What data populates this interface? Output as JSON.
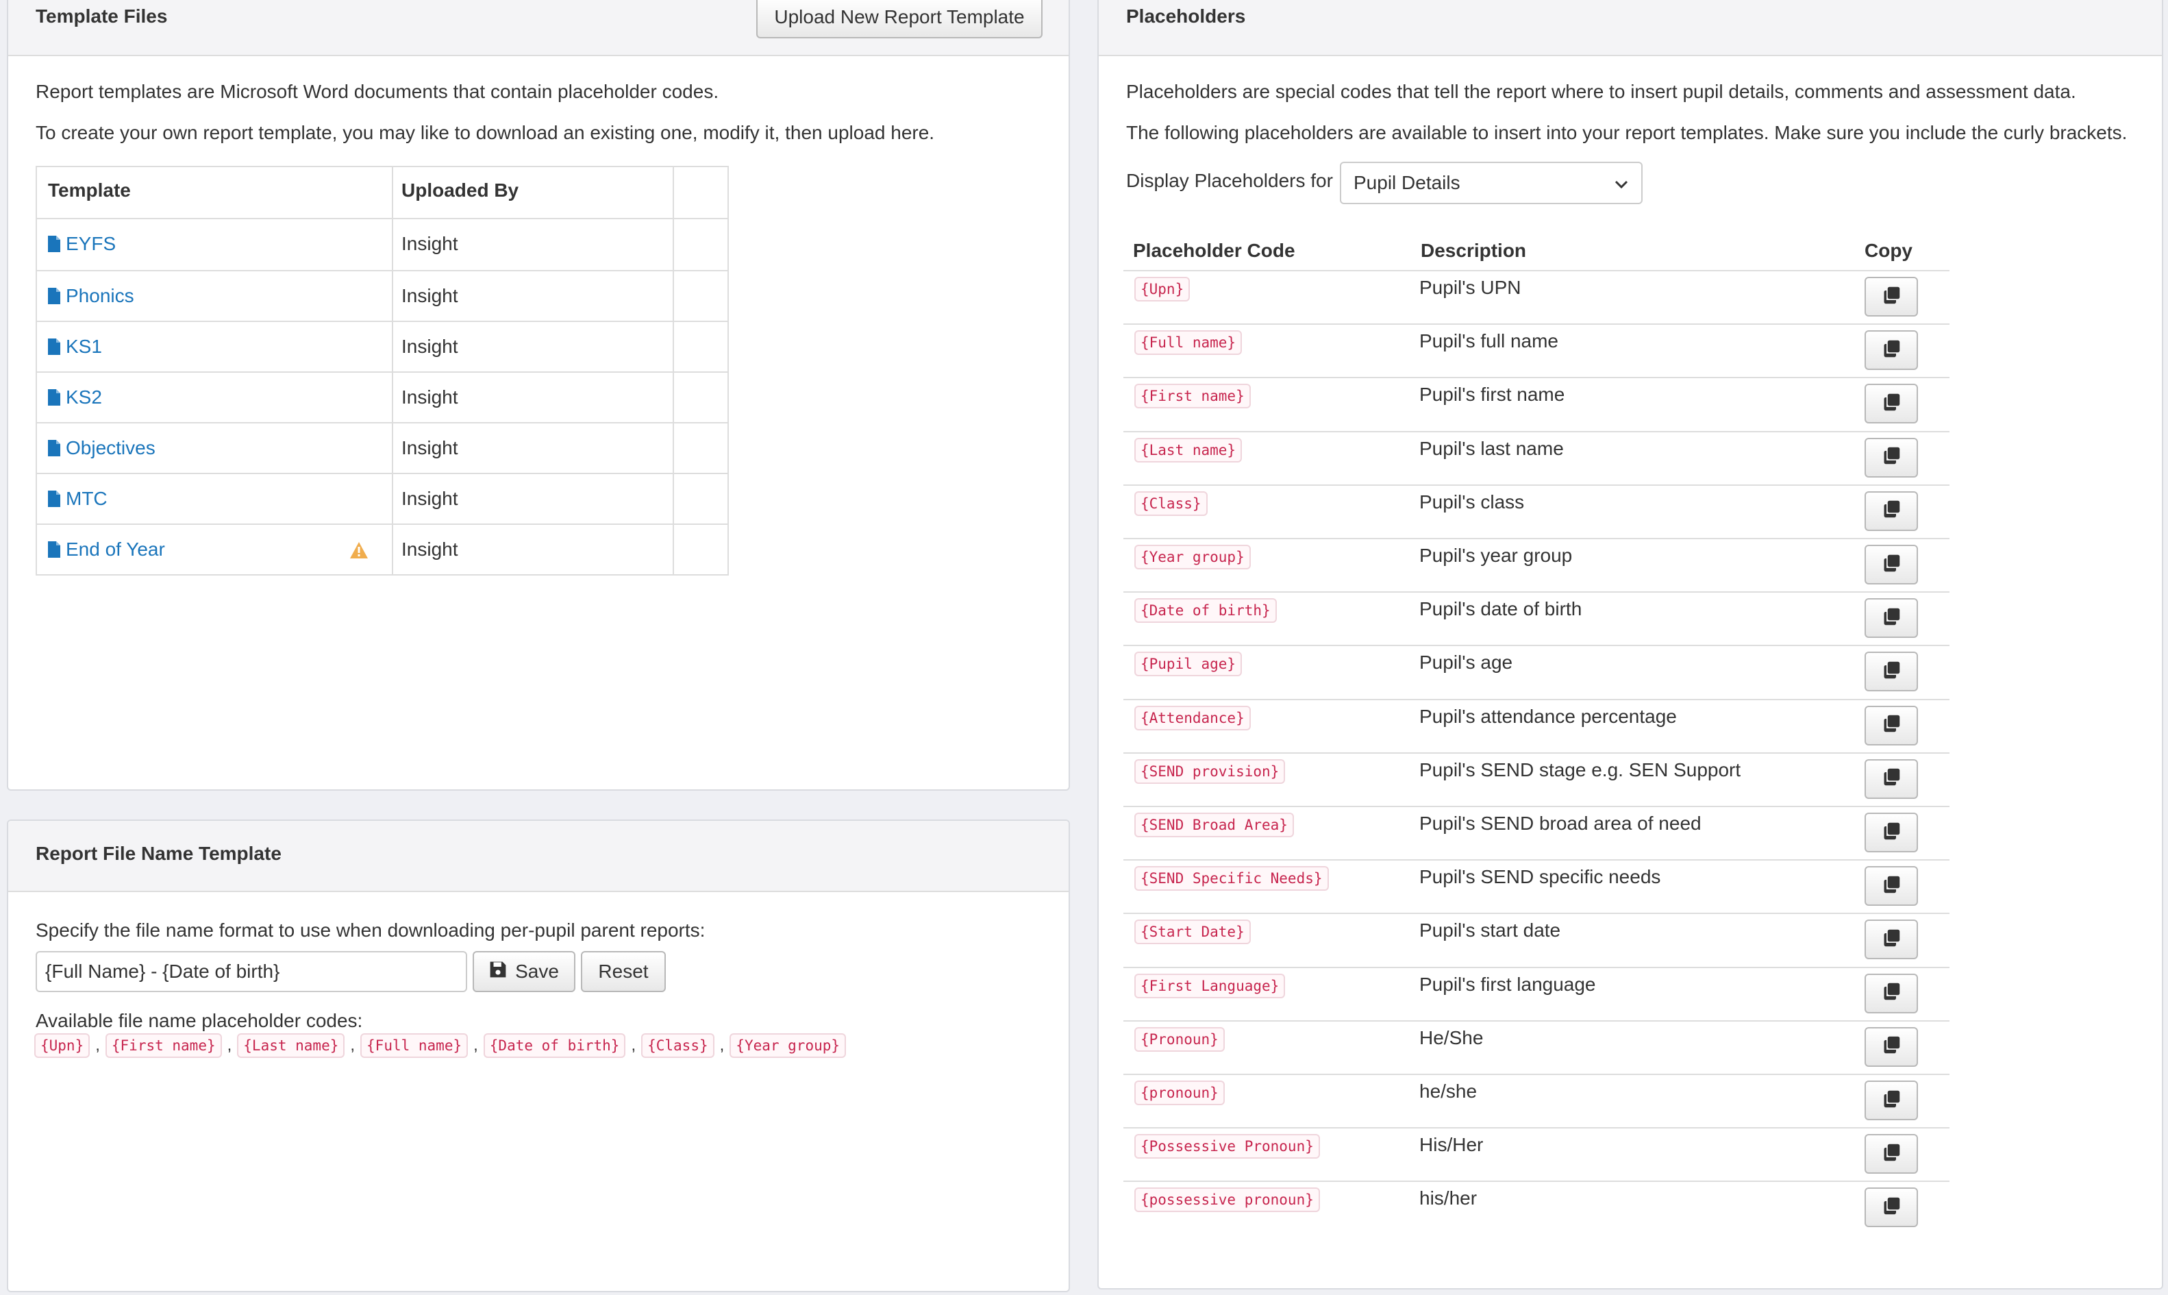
{
  "left_panel": {
    "title": "Template Files",
    "upload_button": "Upload New Report Template",
    "intro_1": "Report templates are Microsoft Word documents that contain placeholder codes.",
    "intro_2": "To create your own report template, you may like to download an existing one, modify it, then upload here.",
    "table": {
      "headers": [
        "Template",
        "Uploaded By",
        ""
      ],
      "rows": [
        {
          "name": "EYFS",
          "uploaded_by": "Insight",
          "warning": false
        },
        {
          "name": "Phonics",
          "uploaded_by": "Insight",
          "warning": false
        },
        {
          "name": "KS1",
          "uploaded_by": "Insight",
          "warning": false
        },
        {
          "name": "KS2",
          "uploaded_by": "Insight",
          "warning": false
        },
        {
          "name": "Objectives",
          "uploaded_by": "Insight",
          "warning": false
        },
        {
          "name": "MTC",
          "uploaded_by": "Insight",
          "warning": false
        },
        {
          "name": "End of Year",
          "uploaded_by": "Insight",
          "warning": true
        }
      ]
    }
  },
  "filename_panel": {
    "title": "Report File Name Template",
    "instruction": "Specify the file name format to use when downloading per-pupil parent reports:",
    "input_value": "{Full Name} - {Date of birth}",
    "save_label": "Save",
    "reset_label": "Reset",
    "available_label": "Available file name placeholder codes:",
    "codes": [
      "{Upn}",
      "{First name}",
      "{Last name}",
      "{Full name}",
      "{Date of birth}",
      "{Class}",
      "{Year group}"
    ],
    "separator": ","
  },
  "placeholders_panel": {
    "title": "Placeholders",
    "intro_1": "Placeholders are special codes that tell the report where to insert pupil details, comments and assessment data.",
    "intro_2": "The following placeholders are available to insert into your report templates. Make sure you include the curly brackets.",
    "display_label": "Display Placeholders for",
    "display_selected": "Pupil Details",
    "headers": {
      "code": "Placeholder Code",
      "description": "Description",
      "copy": "Copy"
    },
    "rows": [
      {
        "code": "{Upn}",
        "description": "Pupil's UPN"
      },
      {
        "code": "{Full name}",
        "description": "Pupil's full name"
      },
      {
        "code": "{First name}",
        "description": "Pupil's first name"
      },
      {
        "code": "{Last name}",
        "description": "Pupil's last name"
      },
      {
        "code": "{Class}",
        "description": "Pupil's class"
      },
      {
        "code": "{Year group}",
        "description": "Pupil's year group"
      },
      {
        "code": "{Date of birth}",
        "description": "Pupil's date of birth"
      },
      {
        "code": "{Pupil age}",
        "description": "Pupil's age"
      },
      {
        "code": "{Attendance}",
        "description": "Pupil's attendance percentage"
      },
      {
        "code": "{SEND provision}",
        "description": "Pupil's SEND stage e.g. SEN Support"
      },
      {
        "code": "{SEND Broad Area}",
        "description": "Pupil's SEND broad area of need"
      },
      {
        "code": "{SEND Specific Needs}",
        "description": "Pupil's SEND specific needs"
      },
      {
        "code": "{Start Date}",
        "description": "Pupil's start date"
      },
      {
        "code": "{First Language}",
        "description": "Pupil's first language"
      },
      {
        "code": "{Pronoun}",
        "description": "He/She"
      },
      {
        "code": "{pronoun}",
        "description": "he/she"
      },
      {
        "code": "{Possessive Pronoun}",
        "description": "His/Her"
      },
      {
        "code": "{possessive pronoun}",
        "description": "his/her"
      }
    ]
  },
  "colors": {
    "link": "#1a75bb",
    "code_text": "#c7254e",
    "warning": "#f0ad4e"
  },
  "icons": {
    "file": "file-icon",
    "warning": "warning-icon",
    "save": "floppy-disk-icon",
    "copy": "copy-icon",
    "dropdown": "chevron-down-icon"
  }
}
